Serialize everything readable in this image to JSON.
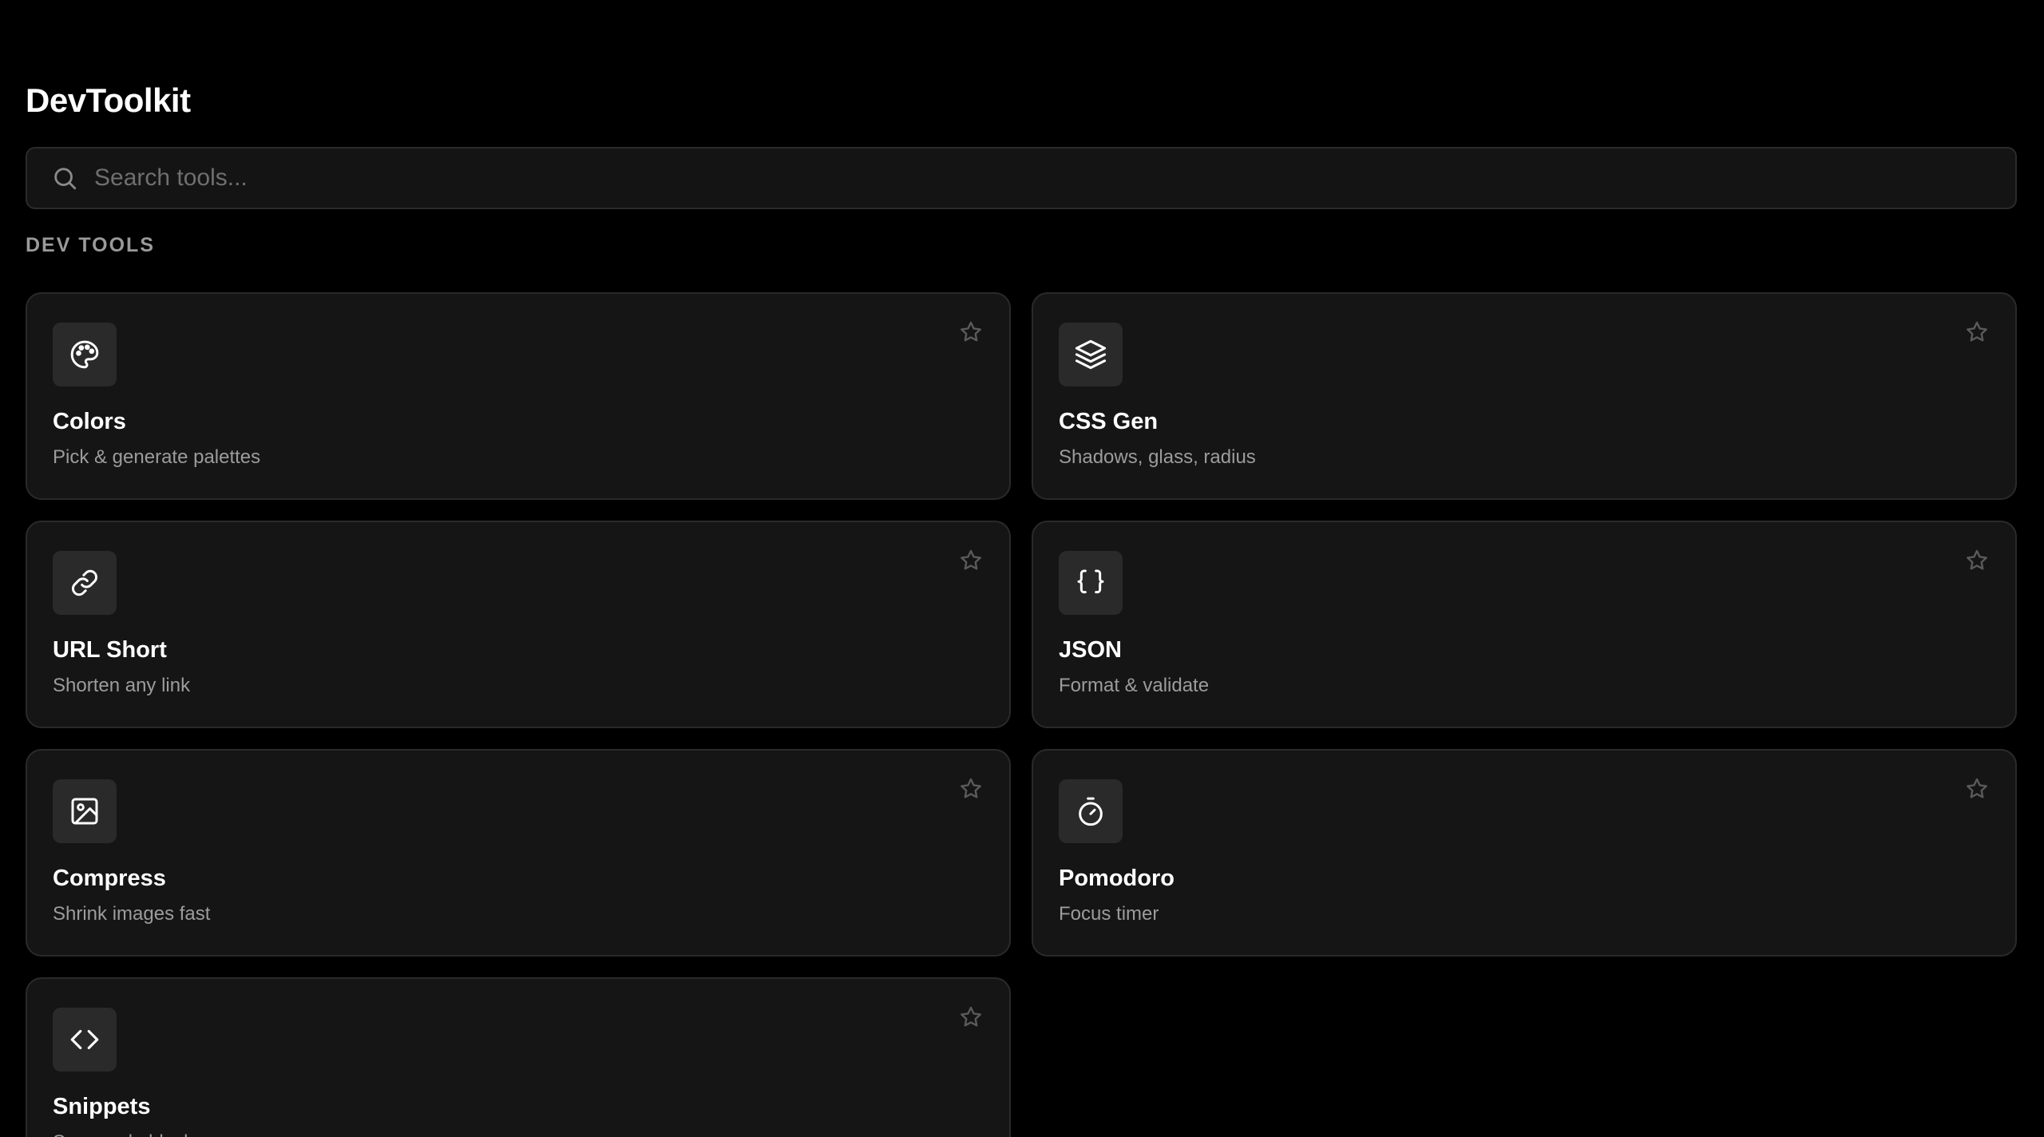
{
  "app": {
    "title": "DevToolkit"
  },
  "search": {
    "placeholder": "Search tools...",
    "value": "",
    "icon": "search-icon"
  },
  "section": {
    "label": "DEV TOOLS"
  },
  "tools": [
    {
      "name": "Colors",
      "description": "Pick & generate palettes",
      "icon": "palette-icon",
      "favorited": false
    },
    {
      "name": "CSS Gen",
      "description": "Shadows, glass, radius",
      "icon": "layers-icon",
      "favorited": false
    },
    {
      "name": "URL Short",
      "description": "Shorten any link",
      "icon": "link-icon",
      "favorited": false
    },
    {
      "name": "JSON",
      "description": "Format & validate",
      "icon": "braces-icon",
      "favorited": false
    },
    {
      "name": "Compress",
      "description": "Shrink images fast",
      "icon": "image-icon",
      "favorited": false
    },
    {
      "name": "Pomodoro",
      "description": "Focus timer",
      "icon": "timer-icon",
      "favorited": false
    },
    {
      "name": "Snippets",
      "description": "Save code blocks",
      "icon": "code-icon",
      "favorited": false
    }
  ],
  "colors": {
    "background": "#000000",
    "card": "#151515",
    "card_border": "#2a2a2a",
    "icon_tile": "#2a2a2a",
    "text_primary": "#ffffff",
    "text_secondary": "#9c9c9c",
    "star": "#5a5a5a"
  }
}
